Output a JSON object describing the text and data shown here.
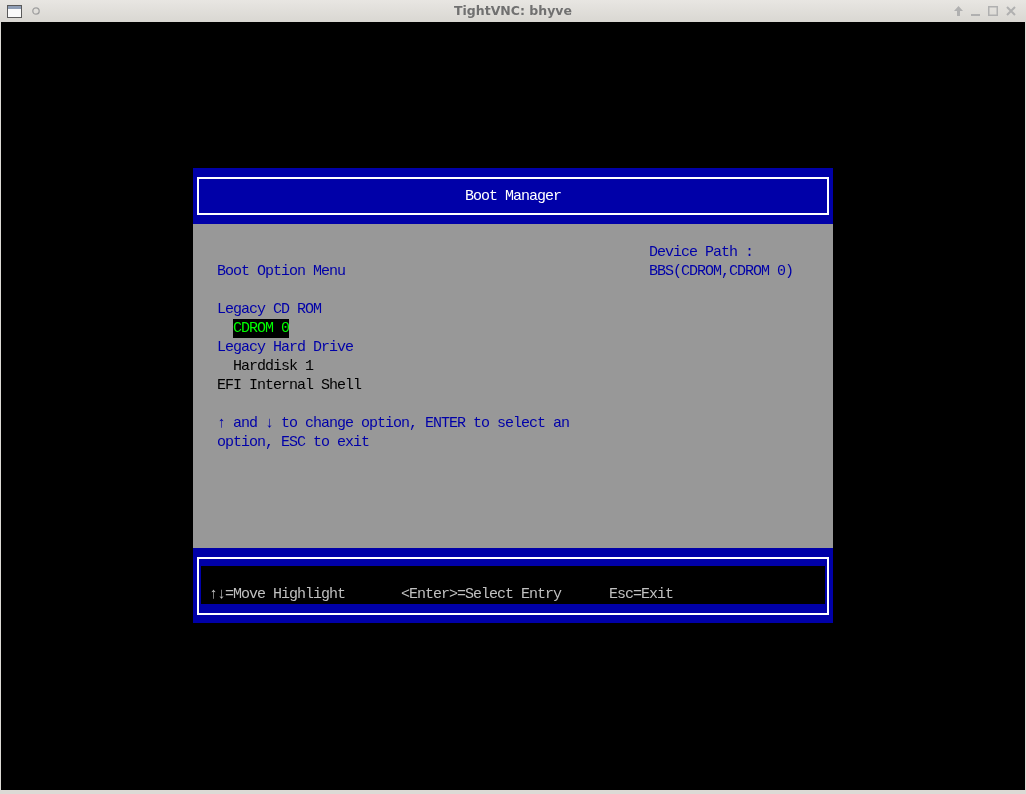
{
  "window": {
    "title": "TightVNC: bhyve"
  },
  "header": {
    "title": "Boot Manager"
  },
  "menu": {
    "title": "Boot Option Menu",
    "items": [
      {
        "kind": "group",
        "label": "Legacy CD ROM",
        "children": [
          {
            "kind": "option",
            "label": "CDROM 0",
            "selected": true
          }
        ]
      },
      {
        "kind": "group",
        "label": "Legacy Hard Drive",
        "children": [
          {
            "kind": "option",
            "label": "Harddisk 1",
            "selected": false
          }
        ]
      },
      {
        "kind": "option",
        "label": "EFI Internal Shell",
        "selected": false
      }
    ],
    "help_text": "↑ and ↓ to change option, ENTER to select an option, ESC to exit"
  },
  "device_path": {
    "label": "Device Path :",
    "value": "BBS(CDROM,CDROM 0)"
  },
  "footer": {
    "hints": [
      "↑↓=Move Highlight",
      "<Enter>=Select Entry",
      "Esc=Exit"
    ]
  }
}
